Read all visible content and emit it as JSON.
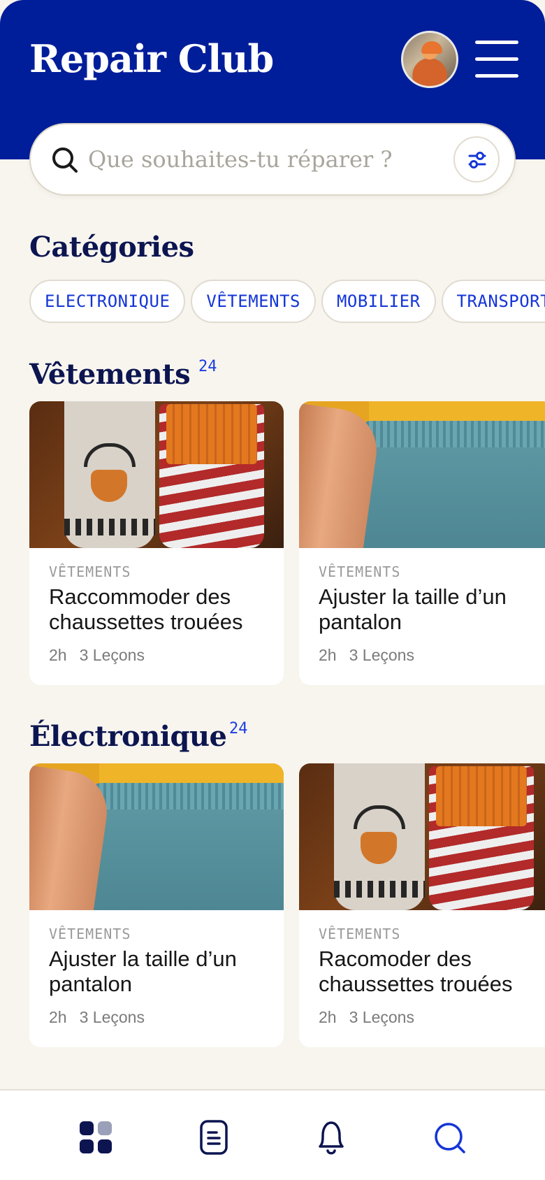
{
  "app": {
    "title": "Repair Club"
  },
  "header": {
    "avatar_icon": "user-avatar",
    "menu_icon": "hamburger-menu-icon"
  },
  "search": {
    "placeholder": "Que souhaites-tu réparer ?",
    "value": "",
    "filter_icon": "sliders-icon"
  },
  "categories": {
    "title": "Catégories",
    "chips": [
      "ELECTRONIQUE",
      "VÊTEMENTS",
      "MOBILIER",
      "TRANSPORT"
    ]
  },
  "sections": [
    {
      "title": "Vêtements",
      "count": "24",
      "cards": [
        {
          "category": "VÊTEMENTS",
          "title": "Raccommoder des chaussettes trouées",
          "duration": "2h",
          "lessons": "3 Leçons",
          "image": "socks"
        },
        {
          "category": "VÊTEMENTS",
          "title": "Ajuster la taille d’un pantalon",
          "duration": "2h",
          "lessons": "3 Leçons",
          "image": "pants"
        }
      ]
    },
    {
      "title": "Électronique",
      "count": "24",
      "cards": [
        {
          "category": "VÊTEMENTS",
          "title": "Ajuster la taille d’un pantalon",
          "duration": "2h",
          "lessons": "3 Leçons",
          "image": "pants"
        },
        {
          "category": "VÊTEMENTS",
          "title": "Racomoder des chaussettes trouées",
          "duration": "2h",
          "lessons": "3 Leçons",
          "image": "socks"
        }
      ]
    }
  ],
  "tabbar": {
    "items": [
      "grid-icon",
      "notes-icon",
      "bell-icon",
      "search-icon"
    ]
  },
  "colors": {
    "header": "#011e9a",
    "background": "#f8f5ef",
    "accent": "#1435d8",
    "title": "#0c1550"
  }
}
